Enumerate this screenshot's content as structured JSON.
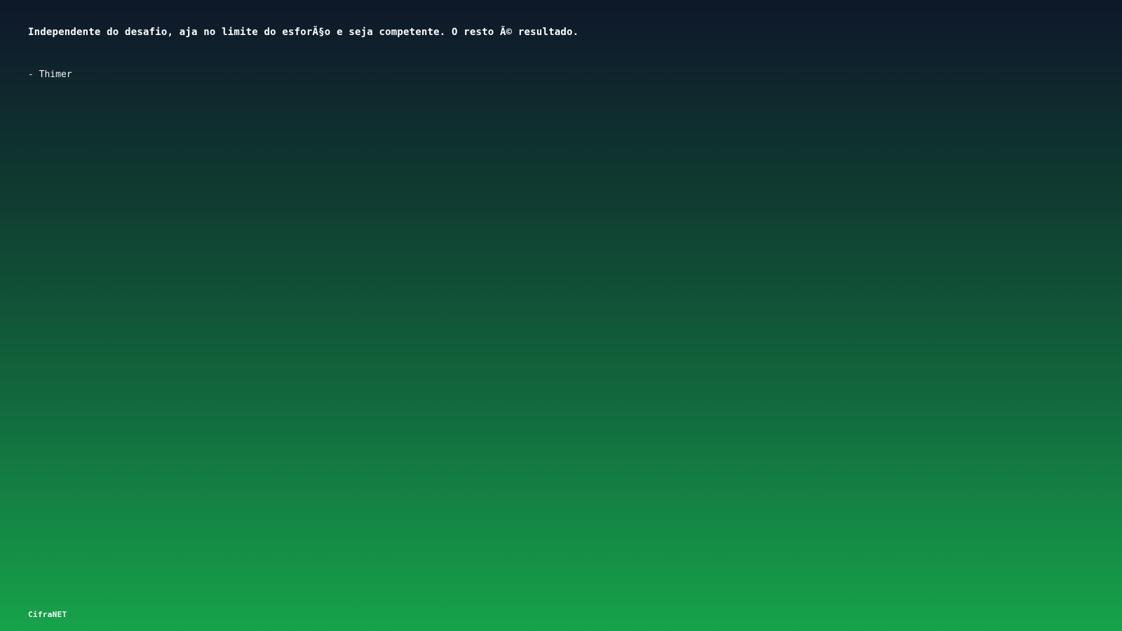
{
  "quote": {
    "text": "Independente do desafio, aja no limite do esforÃ§o e seja competente. O resto Ã© resultado.",
    "author": "- Thimer"
  },
  "footer": {
    "brand": "CifraNET"
  },
  "colors": {
    "gradient_top": "#0f172a",
    "gradient_bottom": "#16a34a",
    "text": "#ffffff"
  }
}
